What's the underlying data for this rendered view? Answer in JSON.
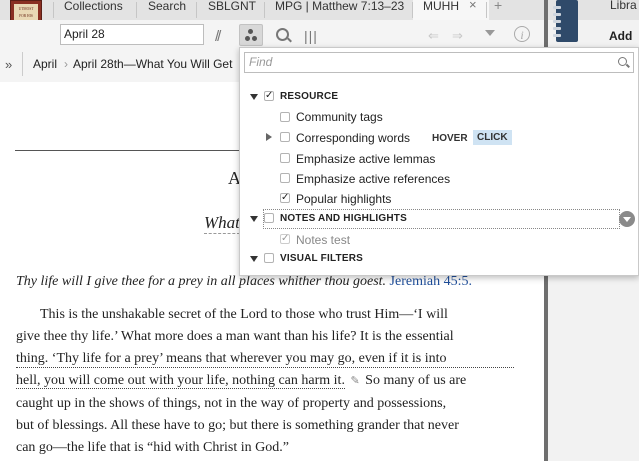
{
  "tabs": [
    "Collections",
    "Search",
    "SBLGNT",
    "MPG | Matthew 7:13–23",
    "MUHH"
  ],
  "tab_close": "×",
  "tab_add": "+",
  "book_thumb_lettering": [
    "UTMOST",
    "FOR HIS",
    "HIGHEST"
  ],
  "right_panel": {
    "top_label": "Libra",
    "add_label": "Add m"
  },
  "toolbar": {
    "reference_value": "April 28",
    "parallel_glyph": "//",
    "columns_glyph": "|||",
    "back_glyph": "⇐",
    "forward_glyph": "⇒",
    "info_glyph": "i"
  },
  "breadcrumb": {
    "expand_glyph": "»",
    "items": [
      "April",
      "April 28th—What You Will Get"
    ],
    "separator": "›"
  },
  "article": {
    "heading_fragment": "A",
    "subheading_fragment": "What",
    "verse_text": "Thy life will I give thee for a prey in all places whither thou goest.",
    "verse_ref": "Jeremiah 45:5.",
    "body_lines": [
      "This is the unshakable secret of the Lord to those who trust Him—‘I will",
      "give thee thy life.’ What more does a man want than his life? It is the essential",
      "thing. ‘Thy life for a prey’ means that wherever you may go, even if it is into",
      "hell, you will come out with your life, nothing can harm it.",
      "So many of us are",
      "caught up in the shows of things, not in the way of property and possessions,",
      "but of blessings. All these have to go; but there is something grander that never",
      "can go—the life that is “hid with Christ in God.”"
    ]
  },
  "panel": {
    "find_placeholder": "Find",
    "sections": [
      {
        "title": "RESOURCE",
        "checked": true,
        "items": [
          {
            "label": "Community tags",
            "checked": false
          },
          {
            "label": "Corresponding words",
            "checked": false
          },
          {
            "label": "Emphasize active lemmas",
            "checked": false
          },
          {
            "label": "Emphasize active references",
            "checked": false
          },
          {
            "label": "Popular highlights",
            "checked": true
          }
        ]
      },
      {
        "title": "NOTES AND HIGHLIGHTS",
        "checked": false,
        "items": [
          {
            "label": "Notes test",
            "checked": true
          }
        ]
      },
      {
        "title": "VISUAL FILTERS",
        "checked": false,
        "items": []
      }
    ],
    "hover_label": "HOVER",
    "click_label": "CLICK",
    "check_glyph": "✓"
  },
  "colors": {
    "verse_ref": "#1f4e9a",
    "click_highlight": "#cfe3f3",
    "gutter": "#6e6e6e"
  }
}
